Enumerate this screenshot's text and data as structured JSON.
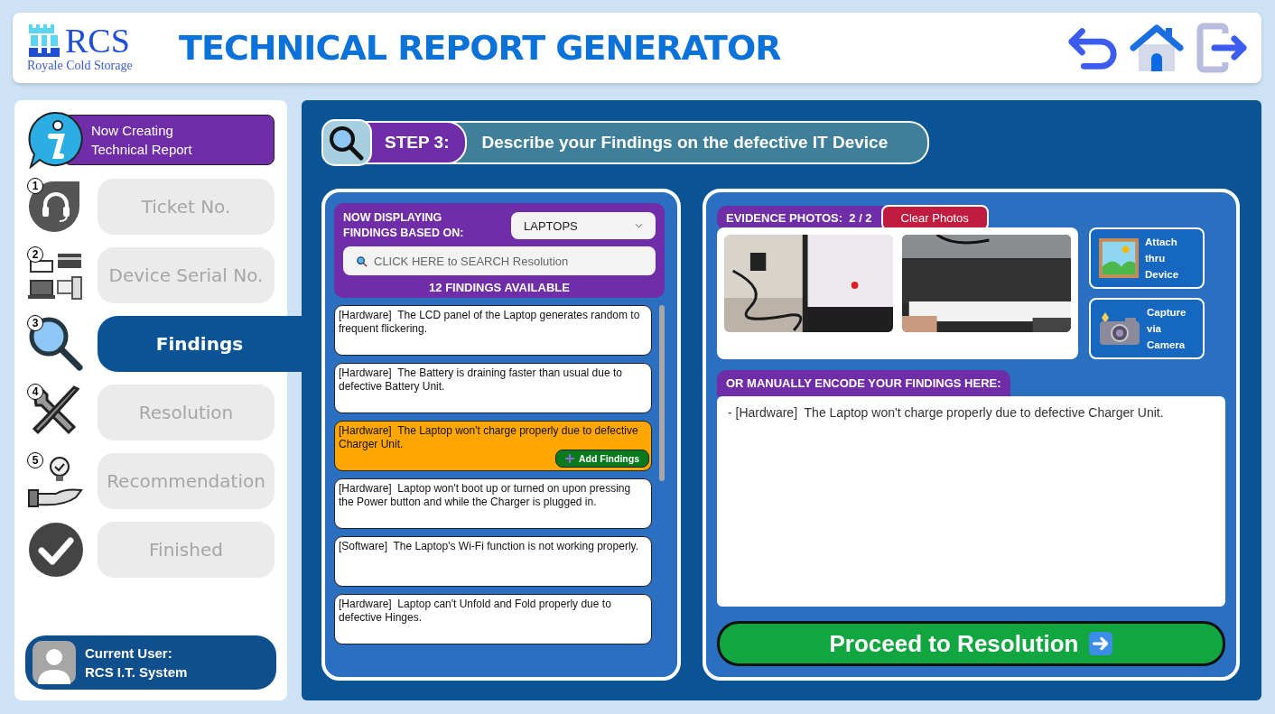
{
  "header": {
    "logo_text": "RCS",
    "logo_subtitle": "Royale Cold Storage",
    "title": "TECHNICAL REPORT GENERATOR"
  },
  "sidebar": {
    "banner": "Now Creating\nTechnical Report",
    "steps": [
      {
        "number": "1",
        "label": "Ticket No.",
        "selected": false
      },
      {
        "number": "2",
        "label": "Device Serial No.",
        "selected": false
      },
      {
        "number": "3",
        "label": "Findings",
        "selected": true
      },
      {
        "number": "4",
        "label": "Resolution",
        "selected": false
      },
      {
        "number": "5",
        "label": "Recommendation",
        "selected": false
      },
      {
        "label": "Finished",
        "selected": false
      }
    ],
    "user": {
      "label": "Current User:",
      "name": "RCS I.T. System"
    }
  },
  "step_header": {
    "step": "STEP 3:",
    "title": "Describe your Findings on the defective IT Device"
  },
  "findings_panel": {
    "filter_label": "NOW DISPLAYING\nFINDINGS BASED ON:",
    "category": "LAPTOPS",
    "search_placeholder": "CLICK HERE to SEARCH Resolution",
    "count": "12 FINDINGS AVAILABLE",
    "add_button": "Add Findings",
    "items": [
      {
        "category": "[Hardware]",
        "text": "The LCD panel of the Laptop generates random to frequent flickering.",
        "selected": false
      },
      {
        "category": "[Hardware]",
        "text": "The Battery is draining faster than usual due to defective Battery Unit.",
        "selected": false
      },
      {
        "category": "[Hardware]",
        "text": "The Laptop won't charge properly due to defective Charger Unit.",
        "selected": true
      },
      {
        "category": "[Hardware]",
        "text": "Laptop won't boot up or turned on upon pressing the Power button and while the Charger is plugged in.",
        "selected": false
      },
      {
        "category": "[Software]",
        "text": "The Laptop's Wi-Fi function is not working properly.",
        "selected": false
      },
      {
        "category": "[Hardware]",
        "text": "Laptop can't Unfold and Fold properly due to defective Hinges.",
        "selected": false
      }
    ]
  },
  "evidence": {
    "label": "EVIDENCE PHOTOS:",
    "count": "2 / 2",
    "clear_button": "Clear Photos",
    "attach_button": "Attach\nthru\nDevice",
    "capture_button": "Capture\nvia\nCamera"
  },
  "manual": {
    "label": "OR MANUALLY ENCODE YOUR FINDINGS HERE:",
    "value": "- [Hardware]  The Laptop won't charge properly due to defective Charger Unit."
  },
  "proceed_button": "Proceed to Resolution"
}
